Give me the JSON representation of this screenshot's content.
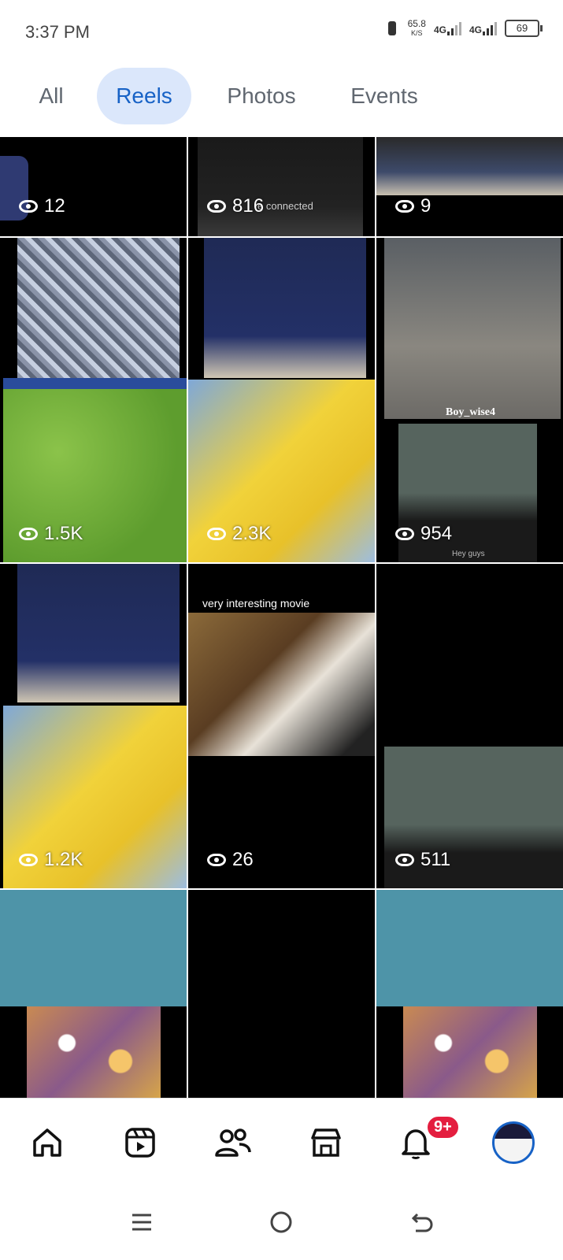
{
  "status": {
    "time": "3:37 PM",
    "speed_value": "65.8",
    "speed_unit": "K/S",
    "net1": "4G",
    "net2": "4G",
    "battery": "69"
  },
  "tabs": [
    {
      "label": "All"
    },
    {
      "label": "Reels"
    },
    {
      "label": "Photos"
    },
    {
      "label": "Events"
    }
  ],
  "reels": [
    {
      "views": "12"
    },
    {
      "views": "816",
      "caption": "e connected"
    },
    {
      "views": "9"
    },
    {
      "views": "1.5K"
    },
    {
      "views": "2.3K"
    },
    {
      "views": "954",
      "caption": "Hey guys",
      "overlay": "Boy_wise4"
    },
    {
      "views": "1.2K"
    },
    {
      "views": "26",
      "caption": "very interesting movie"
    },
    {
      "views": "511"
    },
    {
      "views": ""
    },
    {
      "views": ""
    },
    {
      "views": ""
    }
  ],
  "bottom_nav": {
    "notifications_badge": "9+"
  },
  "colors": {
    "accent": "#1762c6",
    "tab_active_bg": "#dbe7fb",
    "badge": "#e41e3f",
    "teal_thumb": "#4e94a8"
  }
}
